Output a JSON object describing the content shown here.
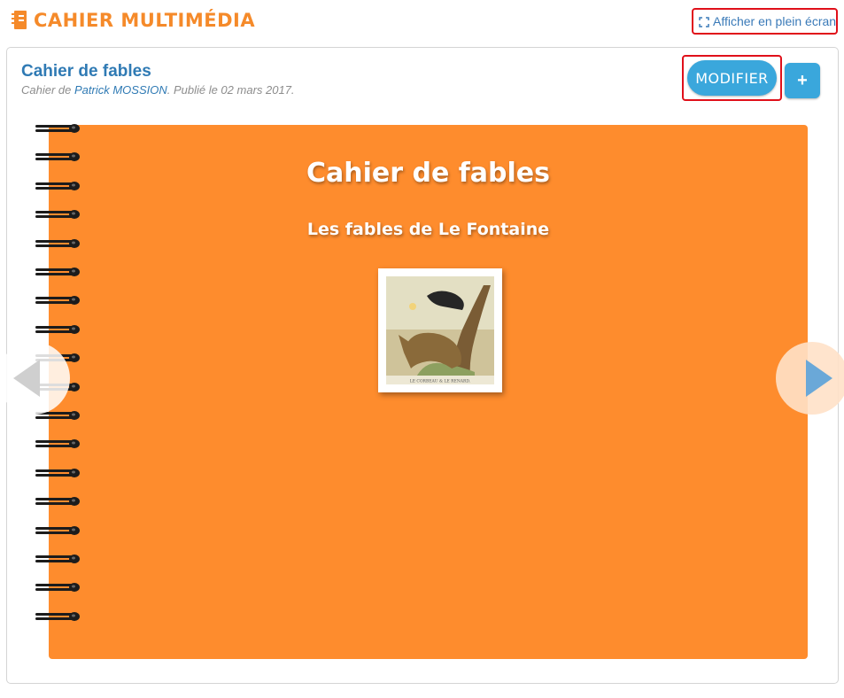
{
  "header": {
    "title": "CAHIER MULTIMÉDIA",
    "fullscreen_label": "Afficher en plein écran"
  },
  "notebook": {
    "title": "Cahier de fables",
    "meta_prefix": "Cahier de ",
    "author": "Patrick MOSSION",
    "meta_suffix": ". Publié le 02 mars 2017.",
    "modify_label": "MODIFIER",
    "add_label": "+"
  },
  "cover": {
    "title": "Cahier de fables",
    "subtitle": "Les fables de Le Fontaine",
    "image_caption": "LE CORBEAU & LE RENARD."
  },
  "colors": {
    "accent": "#f58a2a",
    "cover": "#fe8c2d",
    "button": "#3aa7dc",
    "link": "#2f7ab4"
  },
  "icons": {
    "fullscreen": "fullscreen-icon",
    "logo": "notebook-icon",
    "prev": "arrow-left-icon",
    "next": "arrow-right-icon"
  }
}
